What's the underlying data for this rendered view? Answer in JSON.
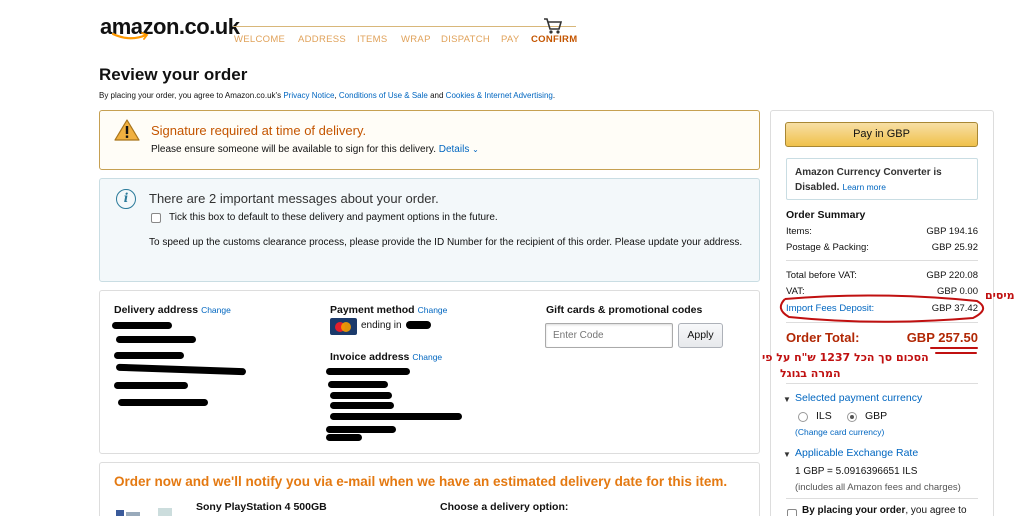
{
  "header": {
    "logo_text": "amazon.co.uk",
    "steps": [
      "WELCOME",
      "ADDRESS",
      "ITEMS",
      "WRAP",
      "DISPATCH",
      "PAY",
      "CONFIRM"
    ],
    "active_step": "CONFIRM"
  },
  "page": {
    "title": "Review your order",
    "agree_prefix": "By placing your order, you agree to Amazon.co.uk's",
    "privacy_link": "Privacy Notice",
    "conditions_link": "Conditions of Use & Sale",
    "and_text": "and",
    "cookies_link": "Cookies & Internet Advertising",
    "agree_suffix": "."
  },
  "signature_notice": {
    "title": "Signature required at time of delivery.",
    "text": "Please ensure someone will be available to sign for this delivery.",
    "details_link": "Details"
  },
  "messages": {
    "title": "There are 2 important messages about your order.",
    "checkbox_label": "Tick this box to default to these delivery and payment options in the future.",
    "customs_text": "To speed up the customs clearance process, please provide the ID Number for the recipient of this order. Please update your address."
  },
  "delivery": {
    "heading": "Delivery address",
    "change_link": "Change"
  },
  "payment": {
    "heading": "Payment method",
    "change_link": "Change",
    "ending_text": "ending in"
  },
  "invoice": {
    "heading": "Invoice address",
    "change_link": "Change"
  },
  "gift": {
    "heading": "Gift cards & promotional codes",
    "placeholder": "Enter Code",
    "apply_label": "Apply"
  },
  "order_section": {
    "notify_text": "Order now and we'll notify you via e-mail when we have an estimated delivery date for this item.",
    "product_name": "Sony PlayStation 4 500GB",
    "choose_delivery": "Choose a delivery option:"
  },
  "summary": {
    "pay_button": "Pay in GBP",
    "converter_text": "Amazon Currency Converter is Disabled.",
    "learn_more": "Learn more",
    "title": "Order Summary",
    "rows": [
      {
        "label": "Items:",
        "value": "GBP 194.16"
      },
      {
        "label": "Postage & Packing:",
        "value": "GBP 25.92"
      },
      {
        "label": "Total before VAT:",
        "value": "GBP 220.08"
      },
      {
        "label": "VAT:",
        "value": "GBP 0.00"
      },
      {
        "label": "Import Fees Deposit:",
        "value": "GBP 37.42"
      }
    ],
    "total_label": "Order Total:",
    "total_value": "GBP 257.50",
    "selected_currency_title": "Selected payment currency",
    "currency_options": [
      "ILS",
      "GBP"
    ],
    "selected_currency": "GBP",
    "change_card_currency": "(Change card currency)",
    "exchange_title": "Applicable Exchange Rate",
    "exchange_rate": "1 GBP = 5.0916396651 ILS",
    "exchange_note": "(includes all Amazon fees and charges)",
    "place_order_prefix": "By placing your order",
    "place_order_suffix": ", you agree to"
  },
  "annotations": {
    "taxes": "מיסים",
    "total_note_line1": "הסכום סך הכל 1237 ש\"ח על פי",
    "total_note_line2": "המרה בגוגל",
    "color": "#c01010"
  },
  "colors": {
    "link": "#0066c0",
    "accent_orange": "#e47911",
    "price_red": "#b12704",
    "warning_orange": "#c45500",
    "button_yellow": "#f0c14b"
  }
}
